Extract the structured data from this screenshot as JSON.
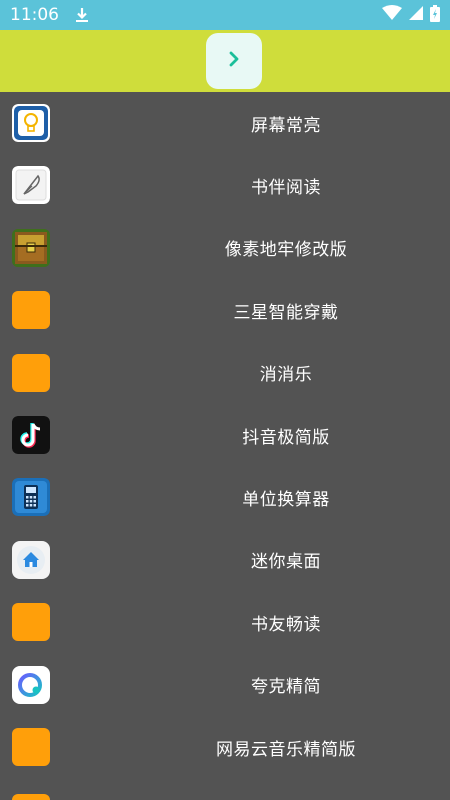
{
  "status_bar": {
    "time": "11:06",
    "background": "#5bc3d9"
  },
  "header": {
    "background": "#cfdd3b",
    "button_icon": "chevron-right-icon",
    "button_color": "#1bbf9a"
  },
  "list": {
    "items": [
      {
        "label": "屏幕常亮",
        "icon": "lightbulb-icon"
      },
      {
        "label": "书伴阅读",
        "icon": "feather-pen-icon"
      },
      {
        "label": "像素地牢修改版",
        "icon": "treasure-chest-icon"
      },
      {
        "label": "三星智能穿戴",
        "icon": "orange-placeholder-icon"
      },
      {
        "label": "消消乐",
        "icon": "orange-placeholder-icon"
      },
      {
        "label": "抖音极简版",
        "icon": "tiktok-icon"
      },
      {
        "label": "单位换算器",
        "icon": "calculator-icon"
      },
      {
        "label": "迷你桌面",
        "icon": "home-icon"
      },
      {
        "label": "书友畅读",
        "icon": "orange-placeholder-icon"
      },
      {
        "label": "夸克精简",
        "icon": "quark-icon"
      },
      {
        "label": "网易云音乐精简版",
        "icon": "orange-placeholder-icon"
      }
    ]
  },
  "colors": {
    "list_background": "#535353",
    "placeholder_orange": "#ff9f0a"
  }
}
